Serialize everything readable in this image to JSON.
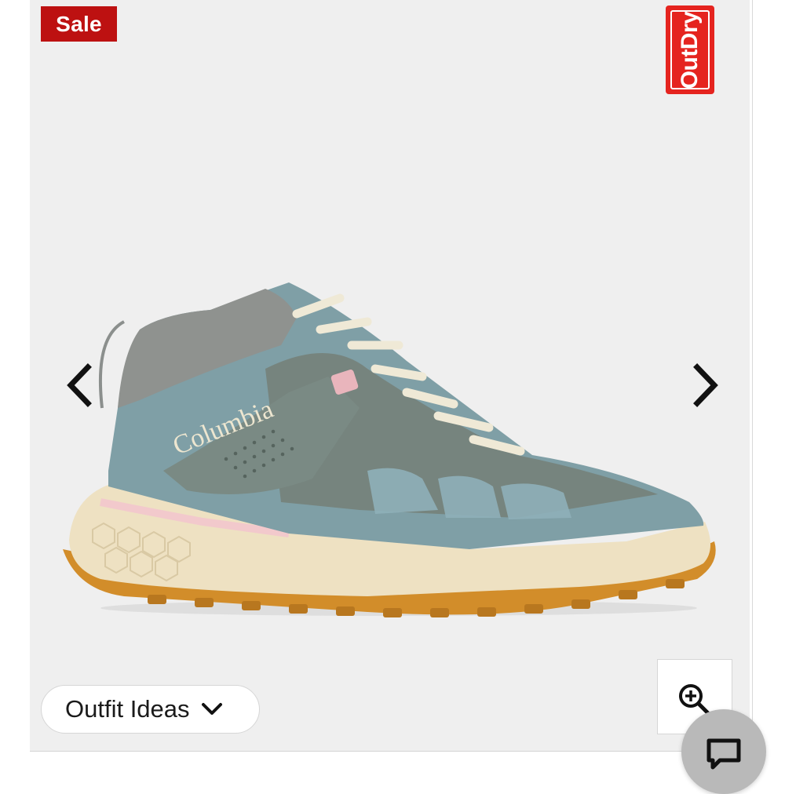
{
  "badge": {
    "sale_label": "Sale"
  },
  "brand_logo": {
    "text": "OutDry",
    "color": "#e5241f"
  },
  "product_image": {
    "brand_text": "Columbia"
  },
  "controls": {
    "prev_icon": "chevron-left-icon",
    "next_icon": "chevron-right-icon",
    "outfit_ideas_label": "Outfit Ideas",
    "outfit_ideas_icon": "chevron-down-icon",
    "zoom_icon": "zoom-in-icon",
    "chat_icon": "chat-bubble-icon"
  },
  "colors": {
    "sale_red": "#bd1111",
    "gallery_background": "#efefef",
    "chat_fab": "#b9b9b9"
  }
}
